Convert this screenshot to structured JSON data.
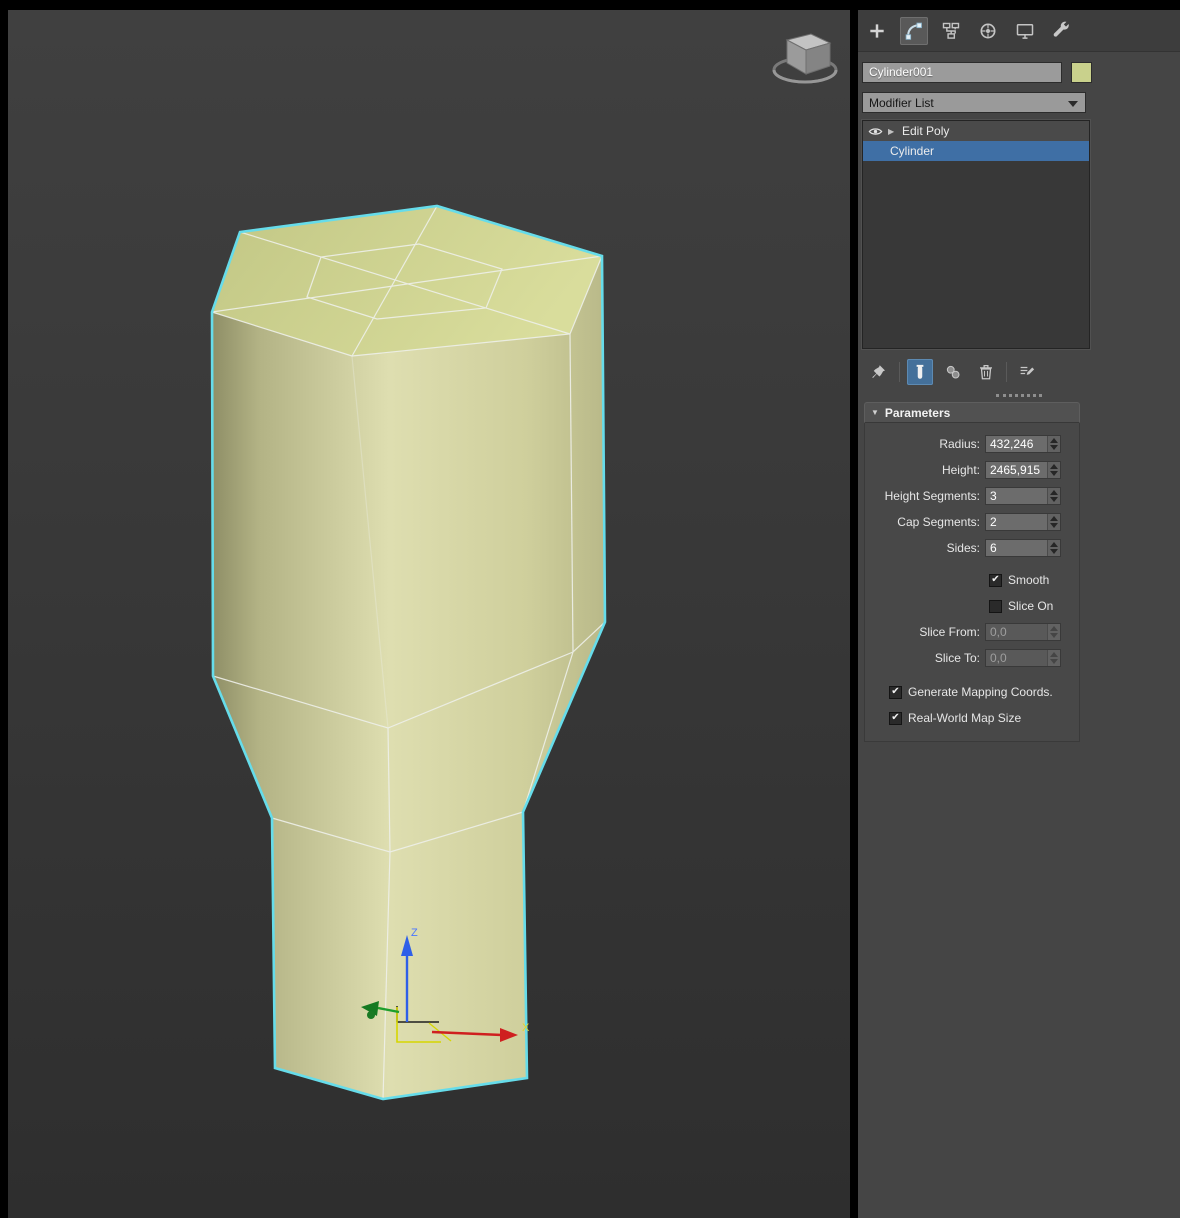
{
  "viewport": {
    "axis_labels": {
      "z": "Z",
      "x": "X"
    },
    "selection_outline_color": "#66dcea",
    "object_fill_color": "#cdd193"
  },
  "panel": {
    "toolbar": {
      "tabs": [
        {
          "name": "create",
          "icon": "plus-icon"
        },
        {
          "name": "modify",
          "icon": "modify-icon",
          "active": true
        },
        {
          "name": "hierarchy",
          "icon": "hierarchy-icon"
        },
        {
          "name": "motion",
          "icon": "motion-icon"
        },
        {
          "name": "display",
          "icon": "display-icon"
        },
        {
          "name": "utilities",
          "icon": "wrench-icon"
        }
      ]
    },
    "object_name": "Cylinder001",
    "object_color": "#c9d18c",
    "modifier_dropdown": {
      "label": "Modifier List"
    },
    "modifier_stack": [
      {
        "label": "Edit Poly",
        "selected": false,
        "expand_glyph": "▶"
      },
      {
        "label": "Cylinder",
        "selected": true
      }
    ],
    "stack_tools": [
      "pin-stack",
      "show-end-result",
      "make-unique",
      "remove-modifier",
      "configure-modifier-sets"
    ],
    "parameters": {
      "title": "Parameters",
      "header_glyph": "▼",
      "fields": [
        {
          "label": "Radius:",
          "value": "432,246",
          "enabled": true
        },
        {
          "label": "Height:",
          "value": "2465,915",
          "enabled": true
        },
        {
          "label": "Height Segments:",
          "value": "3",
          "enabled": true
        },
        {
          "label": "Cap Segments:",
          "value": "2",
          "enabled": true
        },
        {
          "label": "Sides:",
          "value": "6",
          "enabled": true
        },
        {
          "label": "Slice From:",
          "value": "0,0",
          "enabled": false
        },
        {
          "label": "Slice To:",
          "value": "0,0",
          "enabled": false
        }
      ],
      "checkboxes": [
        {
          "label": "Smooth",
          "checked": true,
          "mark": "✔"
        },
        {
          "label": "Slice On",
          "checked": false,
          "mark": ""
        },
        {
          "label": "Generate Mapping Coords.",
          "checked": true,
          "mark": "✔"
        },
        {
          "label": "Real-World Map Size",
          "checked": true,
          "mark": "✔"
        }
      ]
    },
    "colors": {
      "selection_blue": "#3f6fa5",
      "toolbar_bg": "#3d3d3d"
    }
  }
}
